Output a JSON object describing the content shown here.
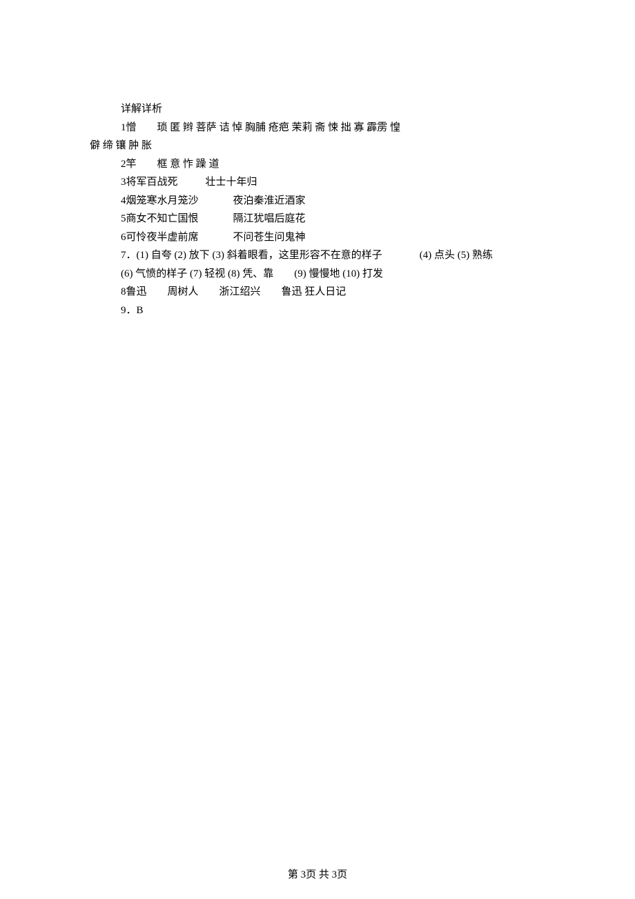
{
  "header": "详解详析",
  "lines": {
    "l1a": "1憎",
    "l1b": "琐 匿 辫 菩萨 诘 悼 胸脯 疮疤 茉莉 斋 悚 拙 寡 霹雳 惶",
    "l1c": "僻 缔 镶 肿 胀",
    "l2a": "2竿",
    "l2b": "框 意 怍 躁 道",
    "l3a": "3将军百战死",
    "l3b": "壮士十年归",
    "l4a": "4烟笼寒水月笼沙",
    "l4b": "夜泊秦淮近酒家",
    "l5a": "5商女不知亡国恨",
    "l5b": "隔江犹唱后庭花",
    "l6a": "6可怜夜半虚前席",
    "l6b": "不问苍生问鬼神",
    "l7a": "7．(1) 自夸 (2) 放下 (3) 斜着眼看，这里形容不在意的样子",
    "l7b": "(4) 点头 (5) 熟练",
    "l7c": " (6) 气愤的样子  (7) 轻视 (8) 凭、靠",
    "l7d": "(9) 慢慢地  (10) 打发",
    "l8a": "8鲁迅",
    "l8b": "周树人",
    "l8c": "浙江绍兴",
    "l8d": "鲁迅 狂人日记",
    "l9": "9．B"
  },
  "footer": "第 3页 共 3页"
}
